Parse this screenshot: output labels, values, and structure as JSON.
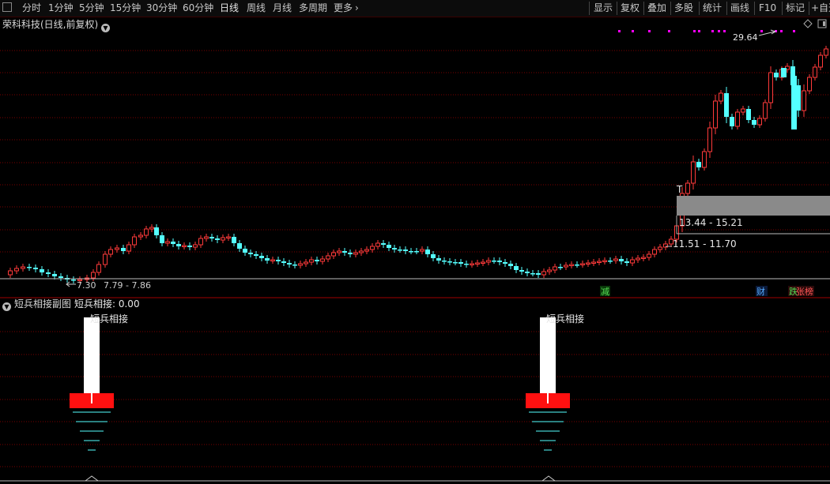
{
  "toolbar": {
    "periods": [
      "分时",
      "1分钟",
      "5分钟",
      "15分钟",
      "30分钟",
      "60分钟",
      "日线",
      "周线",
      "月线",
      "多周期",
      "更多"
    ],
    "active_period": "日线",
    "more_arrow": "›",
    "right_buttons": [
      "显示",
      "复权",
      "叠加",
      "多股",
      "统计",
      "画线",
      "F10",
      "标记",
      "+自选"
    ]
  },
  "main_chart": {
    "title": "荣科科技(日线,前复权)",
    "high_marker_label": "29.64",
    "T_label": "T",
    "range_box_label": "13.44 - 15.21",
    "range_line_label": "11.51 - 11.70",
    "bottom_label": "7.30",
    "bottom_label_2": "7.79 - 7.86",
    "event_labels": [
      {
        "text": "减",
        "color": "#55dd55"
      },
      {
        "text": "财",
        "color": "#55aaff"
      },
      {
        "text": "跌",
        "color": "#55dd55"
      },
      {
        "text": "张榜",
        "color": "#ff5555"
      }
    ],
    "colors": {
      "up": "#ff3a3a",
      "down": "#54ffff",
      "grid": "#7a0000",
      "marker": "#ff00ff"
    }
  },
  "sub_chart": {
    "title": "短兵相接副图",
    "indicator": "短兵相接: 0.00",
    "signal_label": "短兵相接"
  }
}
